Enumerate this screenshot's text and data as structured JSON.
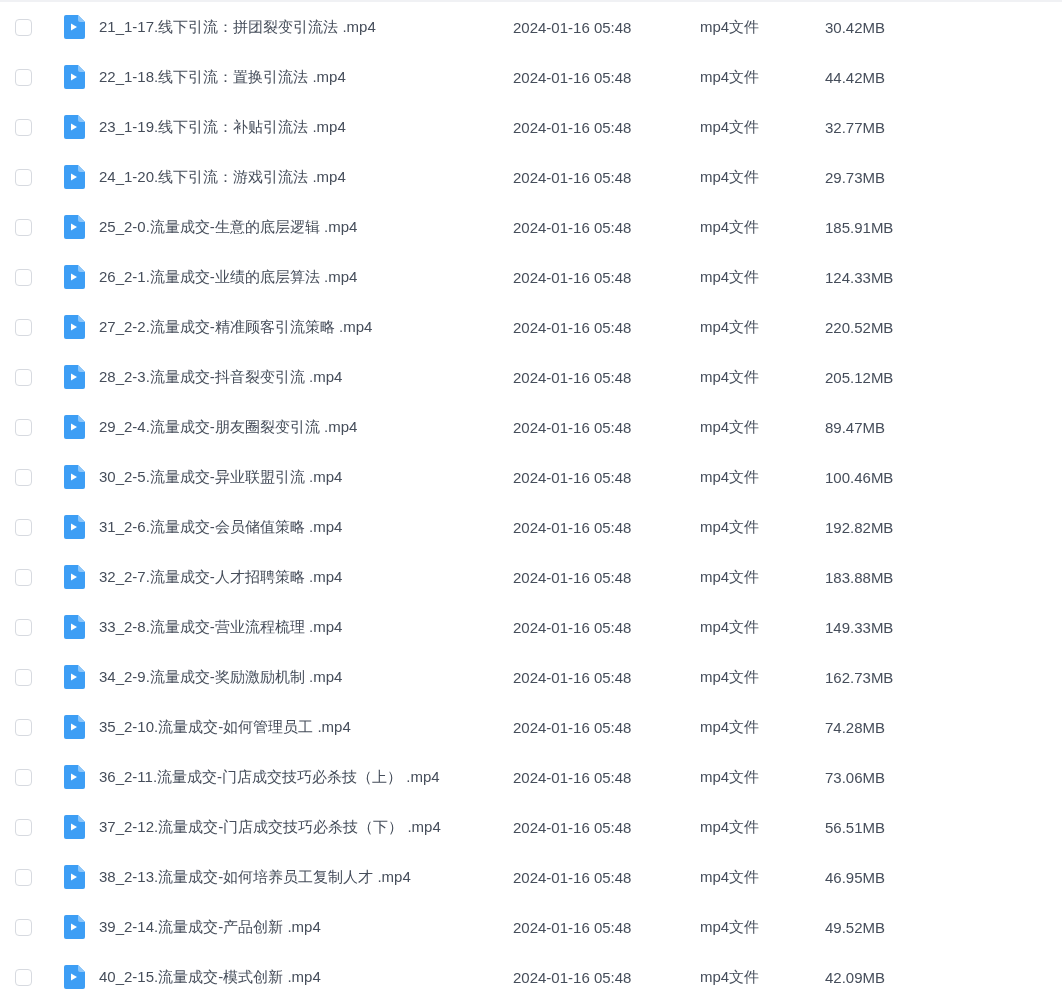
{
  "rows": [
    {
      "name": "21_1-17.线下引流：拼团裂变引流法 .mp4",
      "modified": "2024-01-16 05:48",
      "type": "mp4文件",
      "size": "30.42MB",
      "checked": false
    },
    {
      "name": "22_1-18.线下引流：置换引流法 .mp4",
      "modified": "2024-01-16 05:48",
      "type": "mp4文件",
      "size": "44.42MB",
      "checked": false
    },
    {
      "name": "23_1-19.线下引流：补贴引流法 .mp4",
      "modified": "2024-01-16 05:48",
      "type": "mp4文件",
      "size": "32.77MB",
      "checked": false
    },
    {
      "name": "24_1-20.线下引流：游戏引流法 .mp4",
      "modified": "2024-01-16 05:48",
      "type": "mp4文件",
      "size": "29.73MB",
      "checked": false
    },
    {
      "name": "25_2-0.流量成交-生意的底层逻辑 .mp4",
      "modified": "2024-01-16 05:48",
      "type": "mp4文件",
      "size": "185.91MB",
      "checked": false
    },
    {
      "name": "26_2-1.流量成交-业绩的底层算法 .mp4",
      "modified": "2024-01-16 05:48",
      "type": "mp4文件",
      "size": "124.33MB",
      "checked": false
    },
    {
      "name": "27_2-2.流量成交-精准顾客引流策略 .mp4",
      "modified": "2024-01-16 05:48",
      "type": "mp4文件",
      "size": "220.52MB",
      "checked": false
    },
    {
      "name": "28_2-3.流量成交-抖音裂变引流 .mp4",
      "modified": "2024-01-16 05:48",
      "type": "mp4文件",
      "size": "205.12MB",
      "checked": false
    },
    {
      "name": "29_2-4.流量成交-朋友圈裂变引流 .mp4",
      "modified": "2024-01-16 05:48",
      "type": "mp4文件",
      "size": "89.47MB",
      "checked": false
    },
    {
      "name": "30_2-5.流量成交-异业联盟引流 .mp4",
      "modified": "2024-01-16 05:48",
      "type": "mp4文件",
      "size": "100.46MB",
      "checked": false
    },
    {
      "name": "31_2-6.流量成交-会员储值策略 .mp4",
      "modified": "2024-01-16 05:48",
      "type": "mp4文件",
      "size": "192.82MB",
      "checked": false
    },
    {
      "name": "32_2-7.流量成交-人才招聘策略 .mp4",
      "modified": "2024-01-16 05:48",
      "type": "mp4文件",
      "size": "183.88MB",
      "checked": false
    },
    {
      "name": "33_2-8.流量成交-营业流程梳理 .mp4",
      "modified": "2024-01-16 05:48",
      "type": "mp4文件",
      "size": "149.33MB",
      "checked": false
    },
    {
      "name": "34_2-9.流量成交-奖励激励机制 .mp4",
      "modified": "2024-01-16 05:48",
      "type": "mp4文件",
      "size": "162.73MB",
      "checked": false
    },
    {
      "name": "35_2-10.流量成交-如何管理员工 .mp4",
      "modified": "2024-01-16 05:48",
      "type": "mp4文件",
      "size": "74.28MB",
      "checked": false
    },
    {
      "name": "36_2-11.流量成交-门店成交技巧必杀技（上） .mp4",
      "modified": "2024-01-16 05:48",
      "type": "mp4文件",
      "size": "73.06MB",
      "checked": false
    },
    {
      "name": "37_2-12.流量成交-门店成交技巧必杀技（下） .mp4",
      "modified": "2024-01-16 05:48",
      "type": "mp4文件",
      "size": "56.51MB",
      "checked": false
    },
    {
      "name": "38_2-13.流量成交-如何培养员工复制人才 .mp4",
      "modified": "2024-01-16 05:48",
      "type": "mp4文件",
      "size": "46.95MB",
      "checked": false
    },
    {
      "name": "39_2-14.流量成交-产品创新 .mp4",
      "modified": "2024-01-16 05:48",
      "type": "mp4文件",
      "size": "49.52MB",
      "checked": false
    },
    {
      "name": "40_2-15.流量成交-模式创新 .mp4",
      "modified": "2024-01-16 05:48",
      "type": "mp4文件",
      "size": "42.09MB",
      "checked": false
    }
  ]
}
